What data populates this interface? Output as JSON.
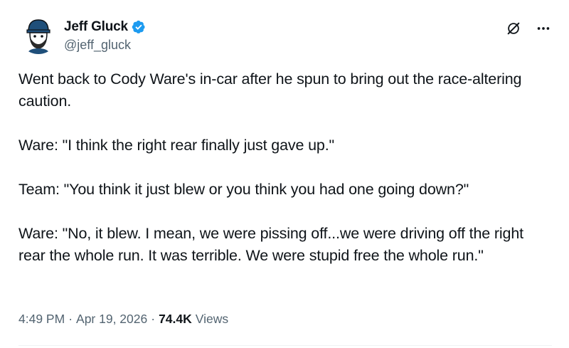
{
  "author": {
    "display_name": "Jeff Gluck",
    "handle": "@jeff_gluck",
    "verified": true,
    "avatar_icon": "cartoon-face-with-cap-avatar"
  },
  "icons": {
    "verified": "verified-badge-icon",
    "grok": "grok-icon",
    "more": "more-options-icon"
  },
  "colors": {
    "verified_blue": "#1d9bf0",
    "text_primary": "#0f1419",
    "text_secondary": "#536471"
  },
  "tweet": {
    "paragraphs": [
      "Went back to Cody Ware's in-car after he spun to bring out the race-altering caution.",
      "Ware: \"I think the right rear finally just gave up.\"",
      "Team: \"You think it just blew or you think you had one going down?\"",
      "Ware: \"No, it blew. I mean, we were pissing off...we were driving off the right rear the whole run. It was terrible. We were stupid free the whole run.\""
    ]
  },
  "meta": {
    "time": "4:49 PM",
    "separator": "·",
    "date": "Apr 19, 2026",
    "views_count": "74.4K",
    "views_label": "Views"
  }
}
